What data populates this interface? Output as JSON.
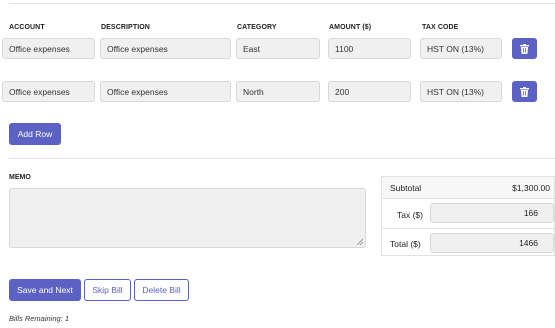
{
  "columns": {
    "account": "ACCOUNT",
    "description": "DESCRIPTION",
    "category": "CATEGORY",
    "amount": "AMOUNT ($)",
    "tax_code": "TAX CODE"
  },
  "rows": [
    {
      "account": "Office expenses",
      "description": "Office expenses",
      "category": "East",
      "amount": "1100",
      "tax_code": "HST ON (13%)"
    },
    {
      "account": "Office expenses",
      "description": "Office expenses",
      "category": "North",
      "amount": "200",
      "tax_code": "HST ON (13%)"
    }
  ],
  "add_row_label": "Add Row",
  "memo": {
    "label": "MEMO",
    "value": ""
  },
  "summary": {
    "subtotal_label": "Subtotal",
    "subtotal_value": "$1,300.00",
    "tax_label": "Tax ($)",
    "tax_value": "166",
    "total_label": "Total ($)",
    "total_value": "1466"
  },
  "actions": {
    "save_next": "Save and Next",
    "skip": "Skip Bill",
    "delete": "Delete Bill"
  },
  "remaining_text": "Bills Remaining: 1",
  "icons": {
    "delete_row": "trash-icon",
    "memo_resize": "resize-grip-icon"
  },
  "colors": {
    "accent": "#5c62c3",
    "field_bg": "#f0f0f0"
  }
}
